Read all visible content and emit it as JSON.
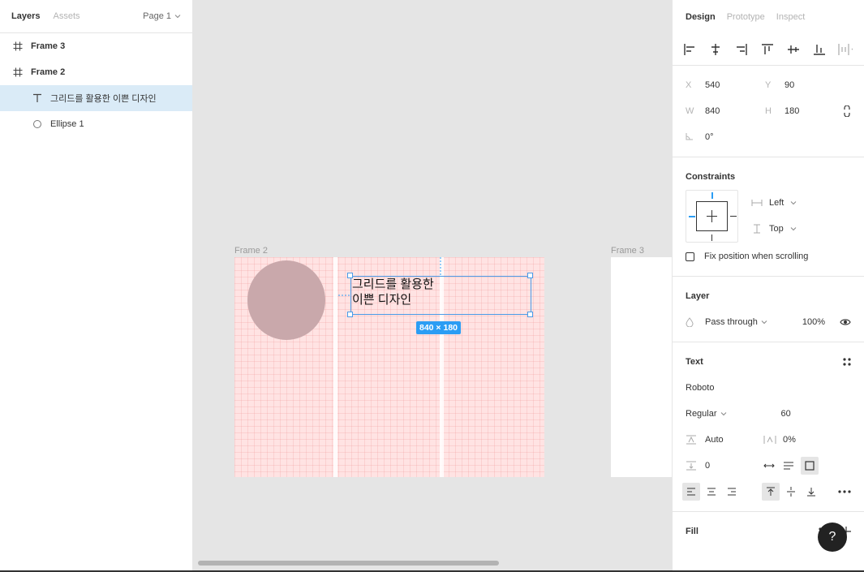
{
  "left_panel": {
    "tabs": [
      "Layers",
      "Assets"
    ],
    "page_label": "Page 1",
    "layers": [
      {
        "name": "Frame 3",
        "icon": "frame-icon"
      },
      {
        "name": "Frame 2",
        "icon": "frame-icon"
      },
      {
        "name": "그리드를 활용한 이쁜 디자인",
        "icon": "text-icon"
      },
      {
        "name": "Ellipse 1",
        "icon": "ellipse-icon"
      }
    ]
  },
  "canvas": {
    "frame2_label": "Frame 2",
    "frame3_label": "Frame 3",
    "text_line1": "그리드를 활용한",
    "text_line2": "이쁜 디자인",
    "dimensions": "840 × 180"
  },
  "right_panel": {
    "tabs": [
      "Design",
      "Prototype",
      "Inspect"
    ],
    "x_label": "X",
    "x_value": "540",
    "y_label": "Y",
    "y_value": "90",
    "w_label": "W",
    "w_value": "840",
    "h_label": "H",
    "h_value": "180",
    "rotation": "0°",
    "constraints_title": "Constraints",
    "constraint_h": "Left",
    "constraint_v": "Top",
    "fix_position": "Fix position when scrolling",
    "layer_title": "Layer",
    "blend_mode": "Pass through",
    "opacity": "100%",
    "text_title": "Text",
    "font_family": "Roboto",
    "font_style": "Regular",
    "font_size": "60",
    "line_height": "Auto",
    "letter_spacing": "0%",
    "paragraph_spacing": "0",
    "fill_title": "Fill",
    "help": "?"
  },
  "colors": {
    "accent": "#2b9df4",
    "selection": "#daebf7",
    "grid_bg": "#ffe3e3"
  }
}
